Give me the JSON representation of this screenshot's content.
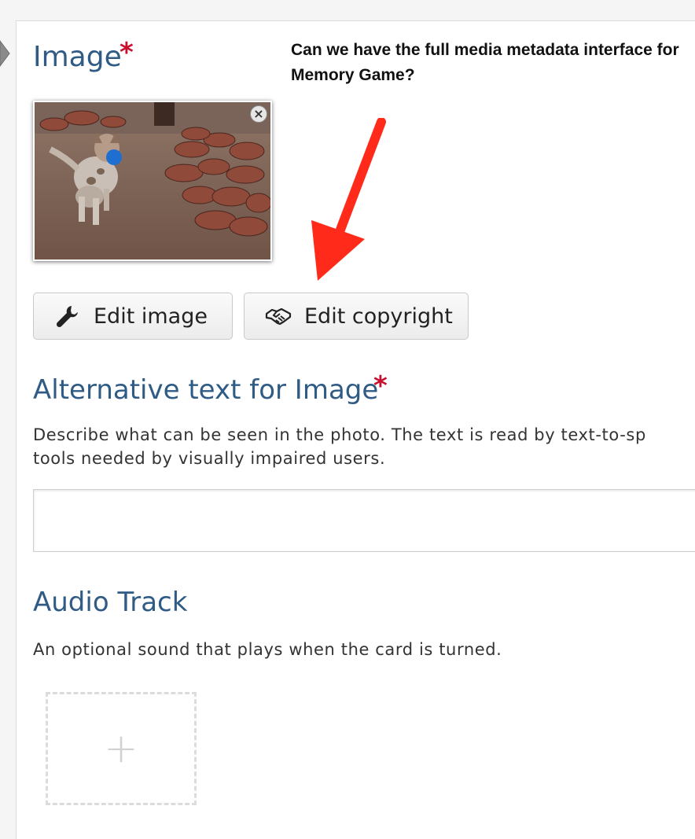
{
  "image_field": {
    "label": "Image",
    "required_mark": "*",
    "thumbnail_alt": "dog carrying blue ball",
    "remove_icon": "×"
  },
  "annotation": {
    "text": "Can we have the full media metadata interface for Memory Game?"
  },
  "buttons": {
    "edit_image": "Edit image",
    "edit_copyright": "Edit copyright"
  },
  "alt_text_field": {
    "label": "Alternative text for Image",
    "required_mark": "*",
    "description_line1": "Describe what can be seen in the photo. The text is read by text-to-sp",
    "description_line2": "tools needed by visually impaired users.",
    "value": ""
  },
  "audio_field": {
    "label": "Audio Track",
    "description": "An optional sound that plays when the card is turned.",
    "add_symbol": "+"
  },
  "colors": {
    "heading": "#2f5b85",
    "required": "#c8102e",
    "annotation_arrow": "#ff2a1a"
  },
  "icons": {
    "edit_image": "wrench-icon",
    "edit_copyright": "handshake-icon",
    "remove": "close-icon",
    "add": "plus-icon"
  }
}
